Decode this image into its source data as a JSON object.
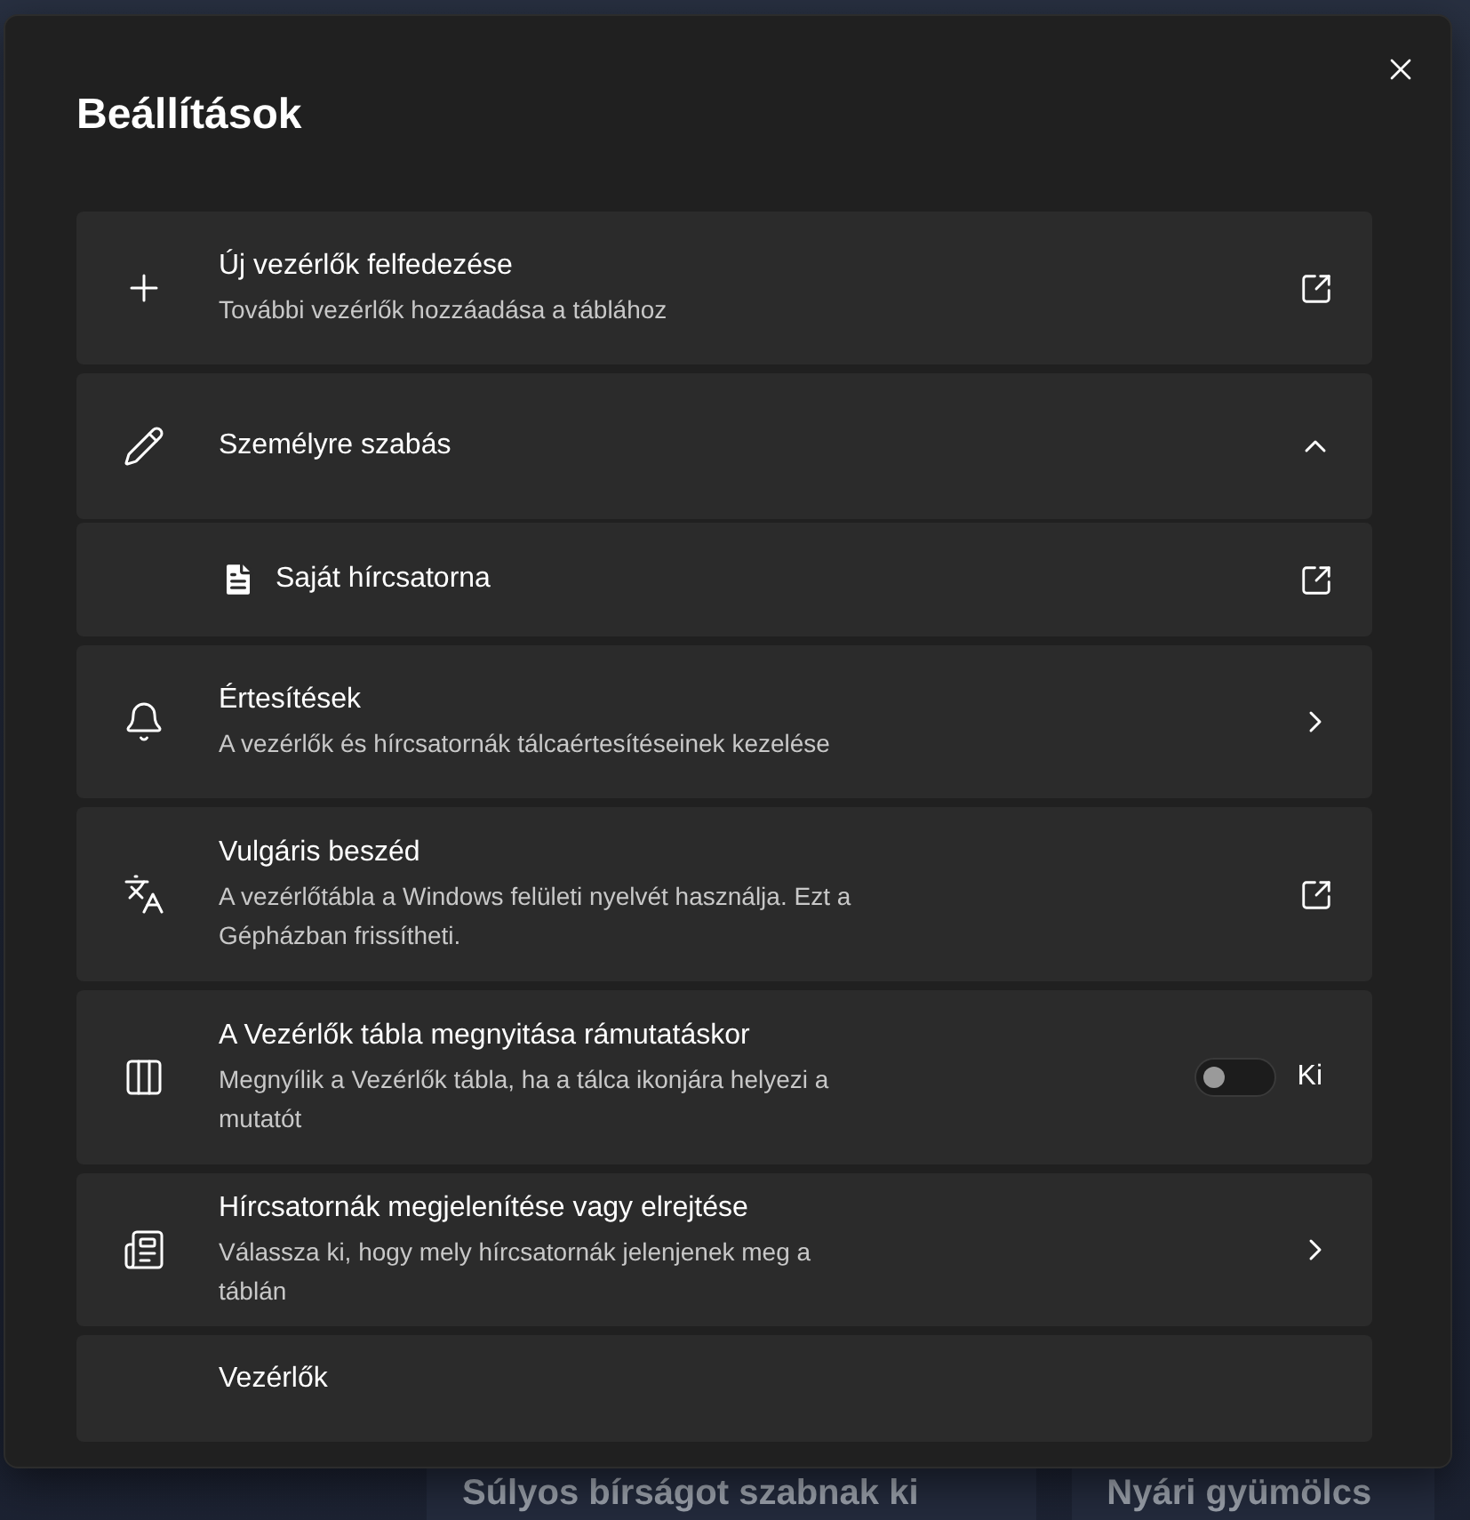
{
  "dialog": {
    "title": "Beállítások"
  },
  "items": [
    {
      "kind": "link",
      "title": "Új vezérlők felfedezése",
      "subtitle": "További vezérlők hozzáadása a táblához"
    },
    {
      "kind": "expander",
      "title": "Személyre szabás",
      "expanded": true,
      "children": [
        {
          "kind": "link",
          "title": "Saját hírcsatorna"
        }
      ]
    },
    {
      "kind": "nav",
      "title": "Értesítések",
      "subtitle": "A vezérlők és hírcsatornák tálcaértesítéseinek kezelése"
    },
    {
      "kind": "link",
      "title": "Vulgáris beszéd",
      "subtitle": "A vezérlőtábla a Windows felületi nyelvét használja. Ezt a Gépházban frissítheti."
    },
    {
      "kind": "toggle",
      "title": "A Vezérlők tábla megnyitása rámutatáskor",
      "subtitle": "Megnyílik a Vezérlők tábla, ha a tálca ikonjára helyezi a mutatót",
      "on": false,
      "state_label": "Ki"
    },
    {
      "kind": "nav",
      "title": "Hírcsatornák megjelenítése vagy elrejtése",
      "subtitle": "Válassza ki, hogy mely hírcsatornák jelenjenek meg a táblán"
    },
    {
      "kind": "heading",
      "title": "Vezérlők"
    }
  ],
  "background": {
    "headlines": [
      "Súlyos bírságot szabnak ki",
      "Nyári gyümölcs"
    ]
  }
}
